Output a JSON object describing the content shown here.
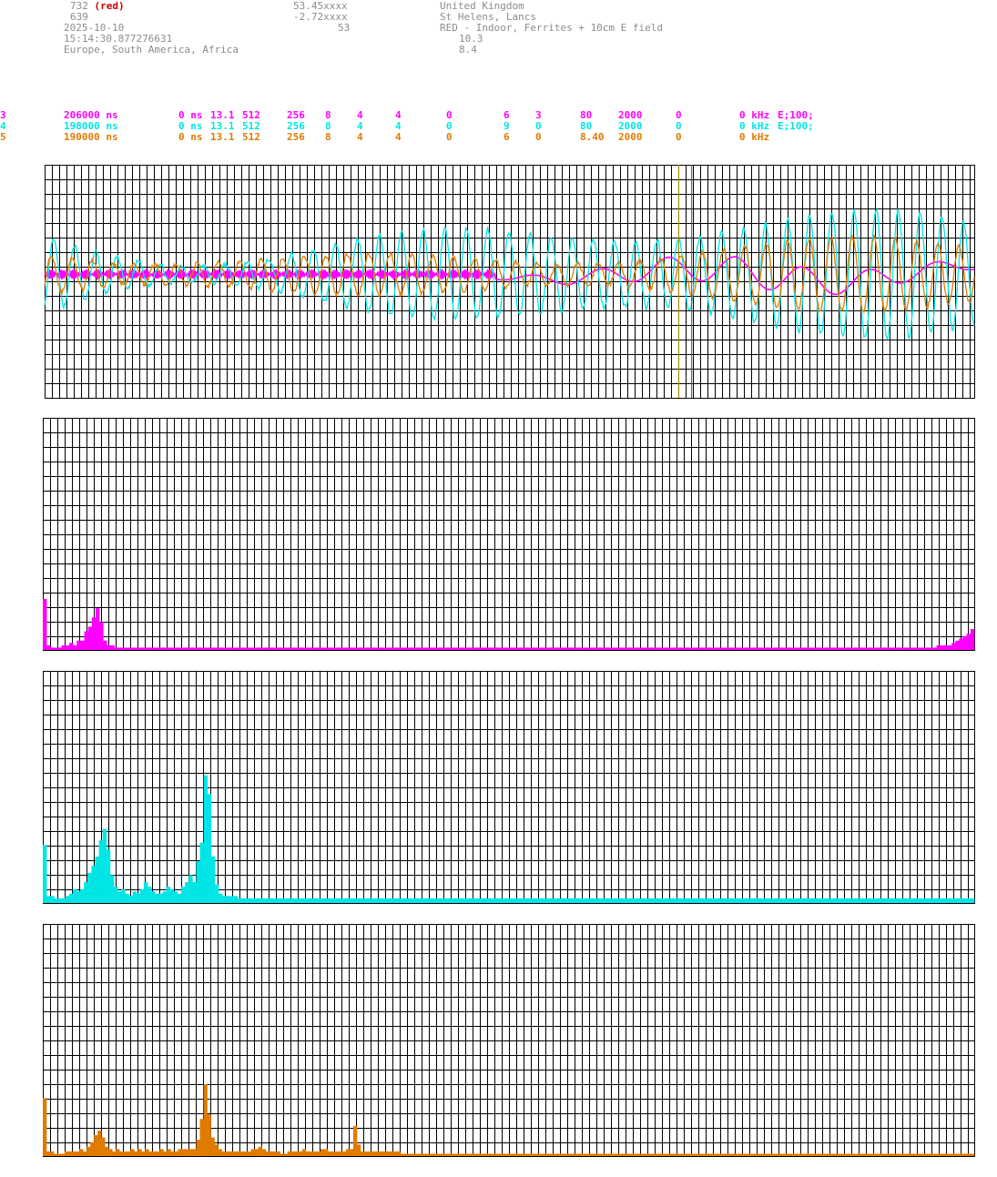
{
  "header": {
    "station_id": "732",
    "station_tag": "(red)",
    "station_num2": "639",
    "date": "2025-10-10",
    "time": "15:14:30.877276631",
    "regions": "Europe, South America, Africa",
    "lat": "53.45xxxx",
    "lon": "-2.72xxxx",
    "alt": "53",
    "country": "United Kingdom",
    "town": "St Helens, Lancs",
    "desc": "RED - Indoor, Ferrites + 10cm E field",
    "val1": "10.3",
    "val2": "8.4"
  },
  "channels": [
    {
      "num": "3",
      "period": "206000 ns",
      "p1": "0 ns",
      "p2": "13.1",
      "p3": "512",
      "p4": "256",
      "p5": "8",
      "p6": "4",
      "p7": "4",
      "p8": "0",
      "p9": "6",
      "p10": "3",
      "p11": "80",
      "p12": "2000",
      "p13": "0",
      "p14": "0 kHz",
      "p15": "E;100;",
      "color": "#ff00ff"
    },
    {
      "num": "4",
      "period": "198000 ns",
      "p1": "0 ns",
      "p2": "13.1",
      "p3": "512",
      "p4": "256",
      "p5": "8",
      "p6": "4",
      "p7": "4",
      "p8": "0",
      "p9": "9",
      "p10": "0",
      "p11": "80",
      "p12": "2000",
      "p13": "0",
      "p14": "0 kHz",
      "p15": "E;100;",
      "color": "#00e5e5"
    },
    {
      "num": "5",
      "period": "190000 ns",
      "p1": "0 ns",
      "p2": "13.1",
      "p3": "512",
      "p4": "256",
      "p5": "8",
      "p6": "4",
      "p7": "4",
      "p8": "0",
      "p9": "6",
      "p10": "0",
      "p11": "8.40",
      "p12": "2000",
      "p13": "0",
      "p14": "0 kHz",
      "p15": "",
      "color": "#e07b00"
    }
  ],
  "chart_data": [
    {
      "type": "line",
      "grid": true,
      "ylim": [
        -1,
        1
      ],
      "markers": [
        0.682,
        0.696
      ],
      "series": [
        {
          "color": "#ff00ff",
          "style": "burst-then-slow",
          "burst_end": 0.485,
          "amp": 0.04,
          "slow_amp": 0.12
        },
        {
          "color": "#00e5e5",
          "style": "oscillation",
          "amp": 0.58
        },
        {
          "color": "#e07b00",
          "style": "oscillation",
          "amp": 0.32
        }
      ]
    },
    {
      "type": "bar",
      "grid": true,
      "color": "#ff00ff",
      "ylim": [
        0,
        1
      ],
      "values": [
        0.22,
        0.02,
        0.01,
        0.01,
        0.01,
        0.02,
        0.02,
        0.03,
        0.02,
        0.04,
        0.04,
        0.08,
        0.1,
        0.14,
        0.18,
        0.12,
        0.04,
        0.02,
        0.02,
        0.01,
        0.01,
        0.01,
        0.01,
        0.01,
        0.01,
        0.01,
        0.01,
        0.01,
        0.01,
        0.01,
        0.01,
        0.01,
        0.01,
        0.01,
        0.01,
        0.01,
        0.01,
        0.01,
        0.01,
        0.01,
        0.01,
        0.01,
        0.01,
        0.01,
        0.01,
        0.01,
        0.01,
        0.01,
        0.01,
        0.01,
        0.01,
        0.01,
        0.01,
        0.01,
        0.01,
        0.01,
        0.01,
        0.01,
        0.01,
        0.01,
        0.01,
        0.01,
        0.01,
        0.01,
        0.01,
        0.01,
        0.01,
        0.01,
        0.01,
        0.01,
        0.01,
        0.01,
        0.01,
        0.01,
        0.01,
        0.01,
        0.01,
        0.01,
        0.01,
        0.01,
        0.01,
        0.01,
        0.01,
        0.01,
        0.01,
        0.01,
        0.01,
        0.01,
        0.01,
        0.01,
        0.01,
        0.01,
        0.01,
        0.01,
        0.01,
        0.01,
        0.01,
        0.01,
        0.01,
        0.01,
        0.01,
        0.01,
        0.01,
        0.01,
        0.01,
        0.01,
        0.01,
        0.01,
        0.01,
        0.01,
        0.01,
        0.01,
        0.01,
        0.01,
        0.01,
        0.01,
        0.01,
        0.01,
        0.01,
        0.01,
        0.01,
        0.01,
        0.01,
        0.01,
        0.01,
        0.01,
        0.01,
        0.01,
        0.01,
        0.01,
        0.01,
        0.01,
        0.01,
        0.01,
        0.01,
        0.01,
        0.01,
        0.01,
        0.01,
        0.01,
        0.01,
        0.01,
        0.01,
        0.01,
        0.01,
        0.01,
        0.01,
        0.01,
        0.01,
        0.01,
        0.01,
        0.01,
        0.01,
        0.01,
        0.01,
        0.01,
        0.01,
        0.01,
        0.01,
        0.01,
        0.01,
        0.01,
        0.01,
        0.01,
        0.01,
        0.01,
        0.01,
        0.01,
        0.01,
        0.01,
        0.01,
        0.01,
        0.01,
        0.01,
        0.01,
        0.01,
        0.01,
        0.01,
        0.01,
        0.01,
        0.01,
        0.01,
        0.01,
        0.01,
        0.01,
        0.01,
        0.01,
        0.01,
        0.01,
        0.01,
        0.01,
        0.01,
        0.01,
        0.01,
        0.01,
        0.01,
        0.01,
        0.01,
        0.01,
        0.01,
        0.01,
        0.01,
        0.01,
        0.01,
        0.01,
        0.01,
        0.01,
        0.01,
        0.01,
        0.01,
        0.01,
        0.01,
        0.01,
        0.01,
        0.01,
        0.01,
        0.01,
        0.01,
        0.01,
        0.01,
        0.01,
        0.01,
        0.01,
        0.01,
        0.01,
        0.01,
        0.01,
        0.01,
        0.01,
        0.01,
        0.01,
        0.01,
        0.01,
        0.01,
        0.01,
        0.01,
        0.01,
        0.02,
        0.02,
        0.02,
        0.02,
        0.03,
        0.04,
        0.05,
        0.06,
        0.07,
        0.09
      ]
    },
    {
      "type": "bar",
      "grid": true,
      "color": "#00e5e5",
      "ylim": [
        0,
        1
      ],
      "values": [
        0.25,
        0.03,
        0.03,
        0.02,
        0.02,
        0.02,
        0.03,
        0.04,
        0.06,
        0.05,
        0.06,
        0.09,
        0.13,
        0.16,
        0.2,
        0.27,
        0.32,
        0.23,
        0.12,
        0.07,
        0.05,
        0.06,
        0.04,
        0.03,
        0.05,
        0.04,
        0.06,
        0.09,
        0.07,
        0.05,
        0.04,
        0.04,
        0.05,
        0.07,
        0.06,
        0.05,
        0.04,
        0.07,
        0.09,
        0.12,
        0.09,
        0.18,
        0.26,
        0.55,
        0.47,
        0.2,
        0.08,
        0.04,
        0.03,
        0.03,
        0.03,
        0.03,
        0.02,
        0.02,
        0.02,
        0.02,
        0.02,
        0.02,
        0.02,
        0.02,
        0.02,
        0.02,
        0.02,
        0.02,
        0.02,
        0.02,
        0.02,
        0.02,
        0.02,
        0.02,
        0.02,
        0.02,
        0.02,
        0.02,
        0.02,
        0.02,
        0.02,
        0.02,
        0.02,
        0.02,
        0.02,
        0.02,
        0.02,
        0.02,
        0.02,
        0.02,
        0.02,
        0.02,
        0.02,
        0.02,
        0.02,
        0.02,
        0.02,
        0.02,
        0.02,
        0.02,
        0.02,
        0.02,
        0.02,
        0.02,
        0.02,
        0.02,
        0.02,
        0.02,
        0.02,
        0.02,
        0.02,
        0.02,
        0.02,
        0.02,
        0.02,
        0.02,
        0.02,
        0.02,
        0.02,
        0.02,
        0.02,
        0.02,
        0.02,
        0.02,
        0.02,
        0.02,
        0.02,
        0.02,
        0.02,
        0.02,
        0.02,
        0.02,
        0.02,
        0.02,
        0.02,
        0.02,
        0.02,
        0.02,
        0.02,
        0.02,
        0.02,
        0.02,
        0.02,
        0.02,
        0.02,
        0.02,
        0.02,
        0.02,
        0.02,
        0.02,
        0.02,
        0.02,
        0.02,
        0.02,
        0.02,
        0.02,
        0.02,
        0.02,
        0.02,
        0.02,
        0.02,
        0.02,
        0.02,
        0.02,
        0.02,
        0.02,
        0.02,
        0.02,
        0.02,
        0.02,
        0.02,
        0.02,
        0.02,
        0.02,
        0.02,
        0.02,
        0.02,
        0.02,
        0.02,
        0.02,
        0.02,
        0.02,
        0.02,
        0.02,
        0.02,
        0.02,
        0.02,
        0.02,
        0.02,
        0.02,
        0.02,
        0.02,
        0.02,
        0.02,
        0.02,
        0.02,
        0.02,
        0.02,
        0.02,
        0.02,
        0.02,
        0.02,
        0.02,
        0.02,
        0.02,
        0.02,
        0.02,
        0.02,
        0.02,
        0.02,
        0.02,
        0.02,
        0.02,
        0.02,
        0.02,
        0.02,
        0.02,
        0.02,
        0.02,
        0.02,
        0.02,
        0.02,
        0.02,
        0.02,
        0.02,
        0.02,
        0.02,
        0.02,
        0.02,
        0.02,
        0.02,
        0.02,
        0.02,
        0.02,
        0.02,
        0.02,
        0.02,
        0.02,
        0.02,
        0.02,
        0.02,
        0.02,
        0.02,
        0.02,
        0.02,
        0.02,
        0.02,
        0.02,
        0.02,
        0.02,
        0.02,
        0.02,
        0.02
      ]
    },
    {
      "type": "bar",
      "grid": true,
      "color": "#e07b00",
      "ylim": [
        0,
        1
      ],
      "values": [
        0.25,
        0.02,
        0.02,
        0.01,
        0.01,
        0.01,
        0.02,
        0.02,
        0.02,
        0.02,
        0.03,
        0.02,
        0.04,
        0.06,
        0.09,
        0.11,
        0.08,
        0.04,
        0.03,
        0.02,
        0.03,
        0.02,
        0.02,
        0.02,
        0.03,
        0.02,
        0.03,
        0.02,
        0.03,
        0.02,
        0.02,
        0.02,
        0.03,
        0.02,
        0.03,
        0.02,
        0.02,
        0.03,
        0.03,
        0.03,
        0.03,
        0.03,
        0.07,
        0.16,
        0.31,
        0.18,
        0.08,
        0.05,
        0.03,
        0.02,
        0.02,
        0.02,
        0.02,
        0.02,
        0.02,
        0.02,
        0.02,
        0.03,
        0.03,
        0.04,
        0.03,
        0.02,
        0.02,
        0.02,
        0.02,
        0.01,
        0.01,
        0.02,
        0.02,
        0.02,
        0.02,
        0.03,
        0.02,
        0.02,
        0.02,
        0.02,
        0.03,
        0.03,
        0.02,
        0.02,
        0.02,
        0.02,
        0.02,
        0.03,
        0.03,
        0.13,
        0.05,
        0.02,
        0.02,
        0.02,
        0.02,
        0.02,
        0.02,
        0.02,
        0.02,
        0.02,
        0.02,
        0.02,
        0.01,
        0.01,
        0.01,
        0.01,
        0.01,
        0.01,
        0.01,
        0.01,
        0.01,
        0.01,
        0.01,
        0.01,
        0.01,
        0.01,
        0.01,
        0.01,
        0.01,
        0.01,
        0.01,
        0.01,
        0.01,
        0.01,
        0.01,
        0.01,
        0.01,
        0.01,
        0.01,
        0.01,
        0.01,
        0.01,
        0.01,
        0.01,
        0.01,
        0.01,
        0.01,
        0.01,
        0.01,
        0.01,
        0.01,
        0.01,
        0.01,
        0.01,
        0.01,
        0.01,
        0.01,
        0.01,
        0.01,
        0.01,
        0.01,
        0.01,
        0.01,
        0.01,
        0.01,
        0.01,
        0.01,
        0.01,
        0.01,
        0.01,
        0.01,
        0.01,
        0.01,
        0.01,
        0.01,
        0.01,
        0.01,
        0.01,
        0.01,
        0.01,
        0.01,
        0.01,
        0.01,
        0.01,
        0.01,
        0.01,
        0.01,
        0.01,
        0.01,
        0.01,
        0.01,
        0.01,
        0.01,
        0.01,
        0.01,
        0.01,
        0.01,
        0.01,
        0.01,
        0.01,
        0.01,
        0.01,
        0.01,
        0.01,
        0.01,
        0.01,
        0.01,
        0.01,
        0.01,
        0.01,
        0.01,
        0.01,
        0.01,
        0.01,
        0.01,
        0.01,
        0.01,
        0.01,
        0.01,
        0.01,
        0.01,
        0.01,
        0.01,
        0.01,
        0.01,
        0.01,
        0.01,
        0.01,
        0.01,
        0.01,
        0.01,
        0.01,
        0.01,
        0.01,
        0.01,
        0.01,
        0.01,
        0.01,
        0.01,
        0.01,
        0.01,
        0.01,
        0.01,
        0.01,
        0.01,
        0.01,
        0.01,
        0.01,
        0.01,
        0.01,
        0.01,
        0.01,
        0.01,
        0.01,
        0.01,
        0.01,
        0.01,
        0.01,
        0.01,
        0.01,
        0.01,
        0.01,
        0.01,
        0.01,
        0.01,
        0.01,
        0.01,
        0.01,
        0.01
      ]
    }
  ]
}
